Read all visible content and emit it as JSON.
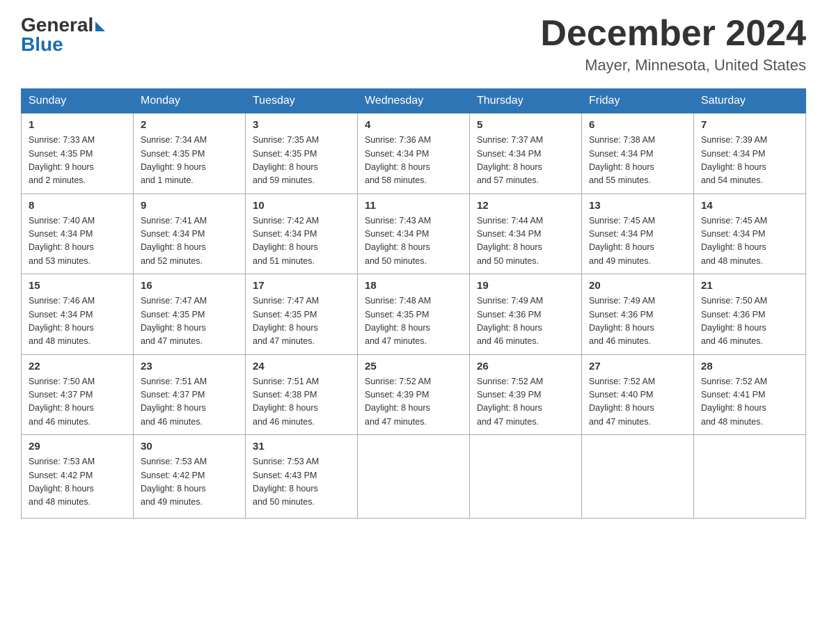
{
  "logo": {
    "general": "General",
    "blue": "Blue"
  },
  "title": "December 2024",
  "location": "Mayer, Minnesota, United States",
  "days_of_week": [
    "Sunday",
    "Monday",
    "Tuesday",
    "Wednesday",
    "Thursday",
    "Friday",
    "Saturday"
  ],
  "weeks": [
    [
      {
        "day": "1",
        "sunrise": "7:33 AM",
        "sunset": "4:35 PM",
        "daylight": "9 hours and 2 minutes."
      },
      {
        "day": "2",
        "sunrise": "7:34 AM",
        "sunset": "4:35 PM",
        "daylight": "9 hours and 1 minute."
      },
      {
        "day": "3",
        "sunrise": "7:35 AM",
        "sunset": "4:35 PM",
        "daylight": "8 hours and 59 minutes."
      },
      {
        "day": "4",
        "sunrise": "7:36 AM",
        "sunset": "4:34 PM",
        "daylight": "8 hours and 58 minutes."
      },
      {
        "day": "5",
        "sunrise": "7:37 AM",
        "sunset": "4:34 PM",
        "daylight": "8 hours and 57 minutes."
      },
      {
        "day": "6",
        "sunrise": "7:38 AM",
        "sunset": "4:34 PM",
        "daylight": "8 hours and 55 minutes."
      },
      {
        "day": "7",
        "sunrise": "7:39 AM",
        "sunset": "4:34 PM",
        "daylight": "8 hours and 54 minutes."
      }
    ],
    [
      {
        "day": "8",
        "sunrise": "7:40 AM",
        "sunset": "4:34 PM",
        "daylight": "8 hours and 53 minutes."
      },
      {
        "day": "9",
        "sunrise": "7:41 AM",
        "sunset": "4:34 PM",
        "daylight": "8 hours and 52 minutes."
      },
      {
        "day": "10",
        "sunrise": "7:42 AM",
        "sunset": "4:34 PM",
        "daylight": "8 hours and 51 minutes."
      },
      {
        "day": "11",
        "sunrise": "7:43 AM",
        "sunset": "4:34 PM",
        "daylight": "8 hours and 50 minutes."
      },
      {
        "day": "12",
        "sunrise": "7:44 AM",
        "sunset": "4:34 PM",
        "daylight": "8 hours and 50 minutes."
      },
      {
        "day": "13",
        "sunrise": "7:45 AM",
        "sunset": "4:34 PM",
        "daylight": "8 hours and 49 minutes."
      },
      {
        "day": "14",
        "sunrise": "7:45 AM",
        "sunset": "4:34 PM",
        "daylight": "8 hours and 48 minutes."
      }
    ],
    [
      {
        "day": "15",
        "sunrise": "7:46 AM",
        "sunset": "4:34 PM",
        "daylight": "8 hours and 48 minutes."
      },
      {
        "day": "16",
        "sunrise": "7:47 AM",
        "sunset": "4:35 PM",
        "daylight": "8 hours and 47 minutes."
      },
      {
        "day": "17",
        "sunrise": "7:47 AM",
        "sunset": "4:35 PM",
        "daylight": "8 hours and 47 minutes."
      },
      {
        "day": "18",
        "sunrise": "7:48 AM",
        "sunset": "4:35 PM",
        "daylight": "8 hours and 47 minutes."
      },
      {
        "day": "19",
        "sunrise": "7:49 AM",
        "sunset": "4:36 PM",
        "daylight": "8 hours and 46 minutes."
      },
      {
        "day": "20",
        "sunrise": "7:49 AM",
        "sunset": "4:36 PM",
        "daylight": "8 hours and 46 minutes."
      },
      {
        "day": "21",
        "sunrise": "7:50 AM",
        "sunset": "4:36 PM",
        "daylight": "8 hours and 46 minutes."
      }
    ],
    [
      {
        "day": "22",
        "sunrise": "7:50 AM",
        "sunset": "4:37 PM",
        "daylight": "8 hours and 46 minutes."
      },
      {
        "day": "23",
        "sunrise": "7:51 AM",
        "sunset": "4:37 PM",
        "daylight": "8 hours and 46 minutes."
      },
      {
        "day": "24",
        "sunrise": "7:51 AM",
        "sunset": "4:38 PM",
        "daylight": "8 hours and 46 minutes."
      },
      {
        "day": "25",
        "sunrise": "7:52 AM",
        "sunset": "4:39 PM",
        "daylight": "8 hours and 47 minutes."
      },
      {
        "day": "26",
        "sunrise": "7:52 AM",
        "sunset": "4:39 PM",
        "daylight": "8 hours and 47 minutes."
      },
      {
        "day": "27",
        "sunrise": "7:52 AM",
        "sunset": "4:40 PM",
        "daylight": "8 hours and 47 minutes."
      },
      {
        "day": "28",
        "sunrise": "7:52 AM",
        "sunset": "4:41 PM",
        "daylight": "8 hours and 48 minutes."
      }
    ],
    [
      {
        "day": "29",
        "sunrise": "7:53 AM",
        "sunset": "4:42 PM",
        "daylight": "8 hours and 48 minutes."
      },
      {
        "day": "30",
        "sunrise": "7:53 AM",
        "sunset": "4:42 PM",
        "daylight": "8 hours and 49 minutes."
      },
      {
        "day": "31",
        "sunrise": "7:53 AM",
        "sunset": "4:43 PM",
        "daylight": "8 hours and 50 minutes."
      },
      null,
      null,
      null,
      null
    ]
  ],
  "labels": {
    "sunrise": "Sunrise:",
    "sunset": "Sunset:",
    "daylight": "Daylight:"
  }
}
